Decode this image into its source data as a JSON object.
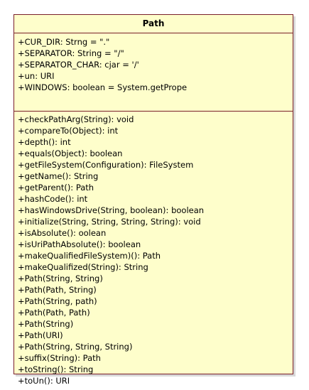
{
  "class_name": "Path",
  "colors": {
    "fill": "#fefecb",
    "border": "#7a1f2a"
  },
  "attributes": [
    "+CUR_DIR: Strng = \".\"",
    "+SEPARATOR: String = \"/\"",
    "+SEPARATOR_CHAR: cjar = '/'",
    "+un: URI",
    "+WINDOWS: boolean = System.getPrope"
  ],
  "operations": [
    "+checkPathArg(String): void",
    "+compareTo(Object): int",
    "+depth(): int",
    "+equals(Object): boolean",
    "+getFileSystem(Configuration): FileSystem",
    "+getName(): String",
    "+getParent(): Path",
    "+hashCode(): int",
    "+hasWindowsDrive(String, boolean): boolean",
    "+initialize(String, String, String, String): void",
    "+isAbsolute(): oolean",
    "+isUriPathAbsolute(): boolean",
    "+makeQualifiedFileSystem)(): Path",
    "+makeQualifized(String): String",
    "+Path(String, String)",
    "+Path(Path, String)",
    "+Path(String, path)",
    "+Path(Path, Path)",
    "+Path(String)",
    "+Path(URI)",
    "+Path(String, String, String)",
    "+suffix(String): Path",
    "+toString(): String",
    "+toUn(): URI"
  ]
}
